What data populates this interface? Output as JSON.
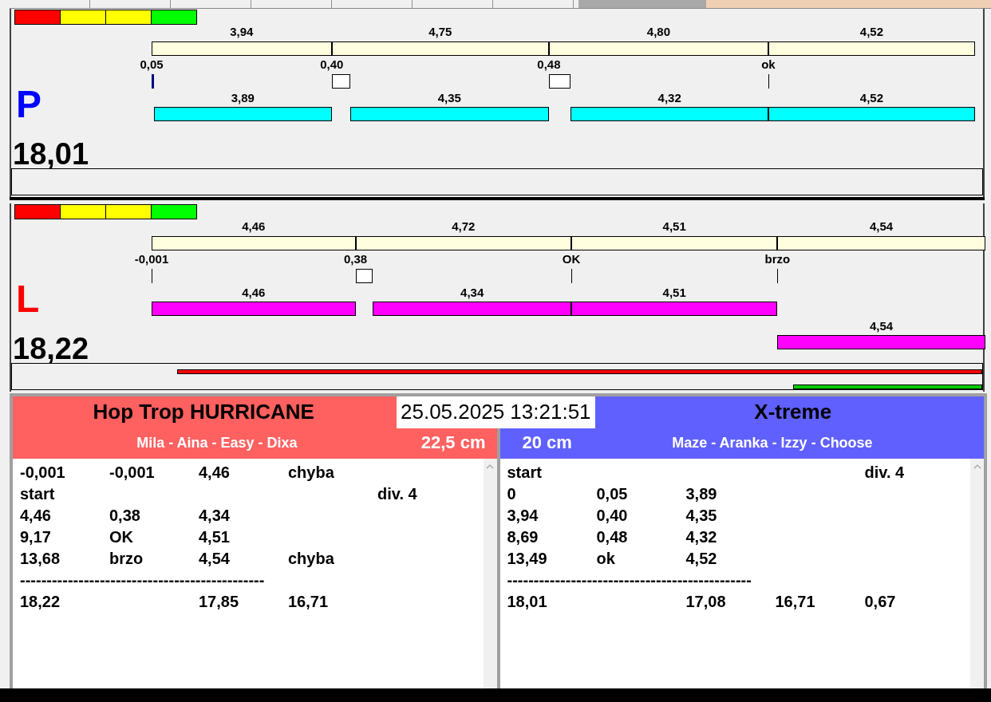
{
  "date_time": "25.05.2025 13:21:51",
  "lanes": [
    {
      "letter": "P",
      "color": "#0000ff",
      "total": "18,01",
      "splits": [
        "3,94",
        "4,75",
        "4,80",
        "4,52"
      ],
      "reactions": [
        "0,05",
        "0,40",
        "0,48",
        "ok"
      ],
      "dog_bars": [
        {
          "time": "3,89",
          "kind": "main",
          "color": "#00ffff"
        },
        {
          "time": "4,35",
          "kind": "main",
          "color": "#00ffff"
        },
        {
          "time": "4,32",
          "kind": "main",
          "color": "#00ffff"
        },
        {
          "time": "4,52",
          "kind": "main",
          "color": "#00ffff"
        }
      ]
    },
    {
      "letter": "L",
      "color": "#ff0000",
      "total": "18,22",
      "splits": [
        "4,46",
        "4,72",
        "4,51",
        "4,54"
      ],
      "reactions": [
        "-0,001",
        "0,38",
        "OK",
        "brzo"
      ],
      "dog_bars": [
        {
          "time": "4,46",
          "kind": "main",
          "color": "#ff00ff"
        },
        {
          "time": "4,34",
          "kind": "main",
          "color": "#ff00ff"
        },
        {
          "time": "4,51",
          "kind": "main",
          "color": "#ff00ff"
        },
        {
          "time": "4,54",
          "kind": "lower",
          "color": "#ff00ff"
        }
      ],
      "progress_bars": [
        {
          "color": "#ff0000",
          "level": 0.83
        },
        {
          "color": "#00cc00",
          "level": 0.195
        }
      ]
    }
  ],
  "teams": [
    {
      "name": "Hop Trop HURRICANE",
      "dogs": "Mila - Aina - Easy - Dixa",
      "size": "22,5 cm",
      "color": "#ff6060",
      "rows": [
        {
          "kind": "entry",
          "cells": [
            "-0,001",
            "-0,001",
            "4,46",
            "chyba",
            null
          ]
        },
        {
          "kind": "entry",
          "cells": [
            "start",
            null,
            null,
            null,
            "div.  4"
          ]
        },
        {
          "kind": "entry",
          "cells": [
            "4,46",
            "0,38",
            "4,34",
            null,
            null
          ]
        },
        {
          "kind": "entry",
          "cells": [
            "9,17",
            "OK",
            "4,51",
            null,
            null
          ]
        },
        {
          "kind": "entry",
          "cells": [
            "13,68",
            "brzo",
            "4,54",
            "chyba",
            null
          ]
        },
        {
          "kind": "separator",
          "text": "----------------------------------------------"
        },
        {
          "kind": "entry",
          "cells": [
            "18,22",
            null,
            "17,85",
            "16,71",
            null
          ]
        }
      ]
    },
    {
      "name": "X-treme",
      "dogs": "Maze - Aranka - Izzy - Choose",
      "size": "20 cm",
      "color": "#6060ff",
      "rows": [
        {
          "kind": "entry",
          "cells": [
            "start",
            null,
            null,
            null,
            "div.  4"
          ]
        },
        {
          "kind": "entry",
          "cells": [
            "0",
            "0,05",
            "3,89",
            null,
            null
          ]
        },
        {
          "kind": "entry",
          "cells": [
            "3,94",
            "0,40",
            "4,35",
            null,
            null
          ]
        },
        {
          "kind": "entry",
          "cells": [
            "8,69",
            "0,48",
            "4,32",
            null,
            null
          ]
        },
        {
          "kind": "entry",
          "cells": [
            "13,49",
            "ok",
            "4,52",
            null,
            null
          ]
        },
        {
          "kind": "separator",
          "text": "----------------------------------------------"
        },
        {
          "kind": "entry",
          "cells": [
            "18,01",
            null,
            "17,08",
            "16,71",
            "0,67"
          ]
        }
      ]
    }
  ]
}
